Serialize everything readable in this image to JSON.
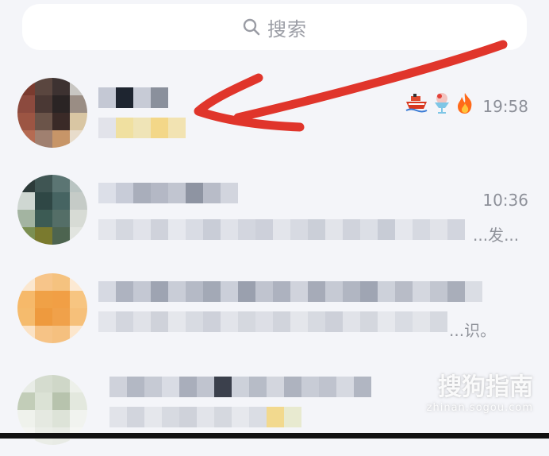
{
  "search": {
    "placeholder": "搜索",
    "icon": "search-icon"
  },
  "chats": [
    {
      "time": "19:58",
      "badges": [
        "ship-icon",
        "shaved-ice-icon",
        "flame-icon"
      ],
      "preview": ""
    },
    {
      "time": "10:36",
      "badges": [],
      "preview": "...发..."
    },
    {
      "time": "",
      "badges": [],
      "preview": "...识。"
    },
    {
      "time": "",
      "badges": [],
      "preview": ""
    }
  ],
  "annotation": {
    "color": "#e0352b"
  },
  "watermark": {
    "main": "搜狗指南",
    "sub": "zhinan.sogou.com"
  }
}
